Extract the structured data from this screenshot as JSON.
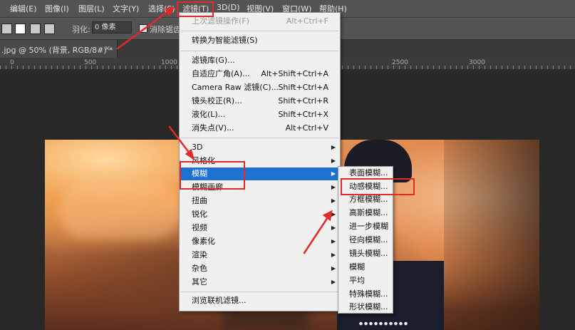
{
  "menubar": {
    "items": [
      {
        "label": "编辑(E)"
      },
      {
        "label": "图像(I)"
      },
      {
        "label": "图层(L)"
      },
      {
        "label": "文字(Y)"
      },
      {
        "label": "选择(S)"
      },
      {
        "label": "滤镜(T)"
      },
      {
        "label": "3D(D)"
      },
      {
        "label": "视图(V)"
      },
      {
        "label": "窗口(W)"
      },
      {
        "label": "帮助(H)"
      }
    ]
  },
  "options": {
    "feather_label": "羽化:",
    "feather_value": "0 像素",
    "antialias_label": "消除锯齿"
  },
  "document": {
    "tab_title": ".jpg @ 50% (背景, RGB/8#) *",
    "close": "×"
  },
  "ruler": {
    "numbers": [
      "0",
      "500",
      "1000",
      "1500",
      "2000",
      "2500",
      "3000"
    ]
  },
  "filter_menu": {
    "last_filter": {
      "label": "上次滤镜操作(F)",
      "shortcut": "Alt+Ctrl+F"
    },
    "smart": {
      "label": "转换为智能滤镜(S)"
    },
    "gallery": {
      "label": "滤镜库(G)..."
    },
    "wide_angle": {
      "label": "自适应广角(A)...",
      "shortcut": "Alt+Shift+Ctrl+A"
    },
    "camera_raw": {
      "label": "Camera Raw 滤镜(C)...",
      "shortcut": "Shift+Ctrl+A"
    },
    "lens": {
      "label": "镜头校正(R)...",
      "shortcut": "Shift+Ctrl+R"
    },
    "liquify": {
      "label": "液化(L)...",
      "shortcut": "Shift+Ctrl+X"
    },
    "vanishing": {
      "label": "消失点(V)...",
      "shortcut": "Alt+Ctrl+V"
    },
    "sub": [
      {
        "label": "3D"
      },
      {
        "label": "风格化"
      },
      {
        "label": "模糊"
      },
      {
        "label": "模糊画廊"
      },
      {
        "label": "扭曲"
      },
      {
        "label": "锐化"
      },
      {
        "label": "视频"
      },
      {
        "label": "像素化"
      },
      {
        "label": "渲染"
      },
      {
        "label": "杂色"
      },
      {
        "label": "其它"
      }
    ],
    "browse": {
      "label": "浏览联机滤镜..."
    }
  },
  "blur_menu": {
    "items": [
      {
        "label": "表面模糊..."
      },
      {
        "label": "动感模糊..."
      },
      {
        "label": "方框模糊..."
      },
      {
        "label": "高斯模糊..."
      },
      {
        "label": "进一步模糊"
      },
      {
        "label": "径向模糊..."
      },
      {
        "label": "镜头模糊..."
      },
      {
        "label": "模糊"
      },
      {
        "label": "平均"
      },
      {
        "label": "特殊模糊..."
      },
      {
        "label": "形状模糊..."
      }
    ]
  },
  "colors": {
    "highlight": "#1f70d1",
    "annotation": "#e32a2a",
    "menu_bg": "#f0f0f0",
    "ui_bg": "#535353"
  }
}
